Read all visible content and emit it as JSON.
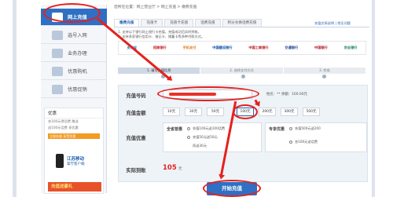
{
  "breadcrumb": "您所在位置：网上营业厅 > 网上充值 > 缴费充值",
  "sidebar": {
    "items": [
      {
        "label": "网上充值"
      },
      {
        "label": "选号入网"
      },
      {
        "label": "业务办理"
      },
      {
        "label": "优惠购机"
      },
      {
        "label": "优惠促销"
      }
    ]
  },
  "promo": {
    "title": "优惠",
    "lines": [
      "充100元得话费 赠送",
      "送100元话费 享优惠"
    ],
    "bar": "立即办理 享受优惠",
    "brand": "江苏移动",
    "brand2": "掌厅客户端",
    "banner": "充值送豪礼"
  },
  "top_link": "充值交易说明 | 常见问题",
  "tabs": [
    {
      "label": "缴费充值"
    },
    {
      "label": "充值卡"
    },
    {
      "label": "充值卡充值"
    },
    {
      "label": "话费充值"
    },
    {
      "label": "积分兑换话费充值"
    }
  ],
  "notice": [
    "1. 支持以下银行网上银行卡充值，充值成功后实时到账。",
    "2. 支持多家银行信用卡、借记卡、储蓄卡等多种付款方式。"
  ],
  "banks": [
    {
      "name": "支付宝",
      "color": "#1b6fc7"
    },
    {
      "name": "招商银行",
      "color": "#c7161d"
    },
    {
      "name": "手机支付",
      "color": "#e07a12"
    },
    {
      "name": "中国建设银行",
      "color": "#0a4fa2"
    },
    {
      "name": "中国工商银行",
      "color": "#b8161d"
    },
    {
      "name": "交通银行",
      "color": "#1b3f8f"
    },
    {
      "name": "中国银行",
      "color": "#b3141b"
    },
    {
      "name": "农业银行",
      "color": "#117a56"
    }
  ],
  "steps": [
    {
      "label": "1. 填写充值信息"
    },
    {
      "label": "2. 选择支付方式"
    },
    {
      "label": "3. 完成"
    }
  ],
  "form": {
    "number_label": "充值号码",
    "owner": "姓名：**   余额：100.00元",
    "amount_label": "充值金额",
    "amounts": [
      "10元",
      "30元",
      "50元",
      "100元",
      "200元",
      "300元",
      "500元"
    ],
    "offer_label": "充值优惠",
    "offer_a": {
      "t1": "全省普惠",
      "t2": "充值100元送100话费",
      "t3": "充值50元送50元",
      "t4": "再送30元"
    },
    "offer_b": {
      "t1": "专享优惠",
      "t2": "充值500元送200",
      "t3": "充100元送话费"
    },
    "pay_label": "实际到账",
    "pay_value": "105",
    "pay_unit": "元"
  },
  "submit": "开始充值"
}
